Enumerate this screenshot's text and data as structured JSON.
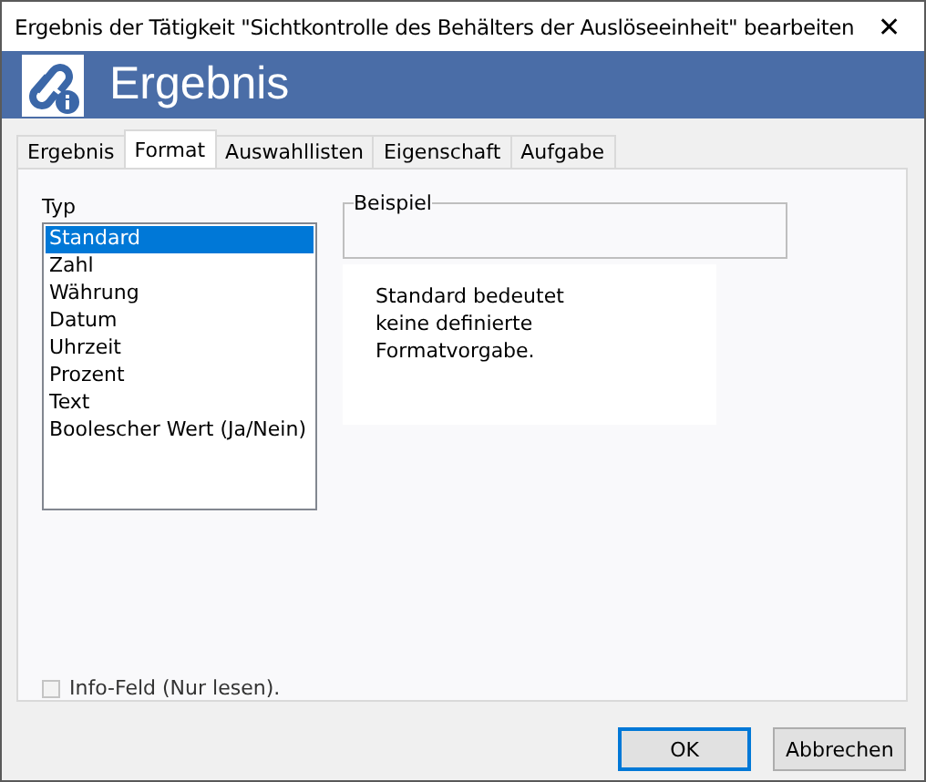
{
  "window": {
    "title": "Ergebnis der Tätigkeit \"Sichtkontrolle des Behälters der Auslöseeinheit\" bearbeiten",
    "close": "✕"
  },
  "banner": {
    "title": "Ergebnis"
  },
  "tabs": [
    {
      "label": "Ergebnis",
      "selected": false
    },
    {
      "label": "Format",
      "selected": true
    },
    {
      "label": "Auswahllisten",
      "selected": false
    },
    {
      "label": "Eigenschaft",
      "selected": false
    },
    {
      "label": "Aufgabe",
      "selected": false
    }
  ],
  "type_list": {
    "label": "Typ",
    "items": [
      {
        "label": "Standard",
        "selected": true
      },
      {
        "label": "Zahl",
        "selected": false
      },
      {
        "label": "Währung",
        "selected": false
      },
      {
        "label": "Datum",
        "selected": false
      },
      {
        "label": "Uhrzeit",
        "selected": false
      },
      {
        "label": "Prozent",
        "selected": false
      },
      {
        "label": "Text",
        "selected": false
      },
      {
        "label": "Boolescher Wert (Ja/Nein)",
        "selected": false
      }
    ]
  },
  "example": {
    "label": "Beispiel",
    "description": "Standard bedeutet keine definierte Formatvorgabe."
  },
  "info_field": {
    "label": "Info-Feld (Nur lesen).",
    "checked": false,
    "disabled": true
  },
  "buttons": [
    {
      "label": "OK",
      "default": true
    },
    {
      "label": "Abbrechen",
      "default": false
    }
  ]
}
